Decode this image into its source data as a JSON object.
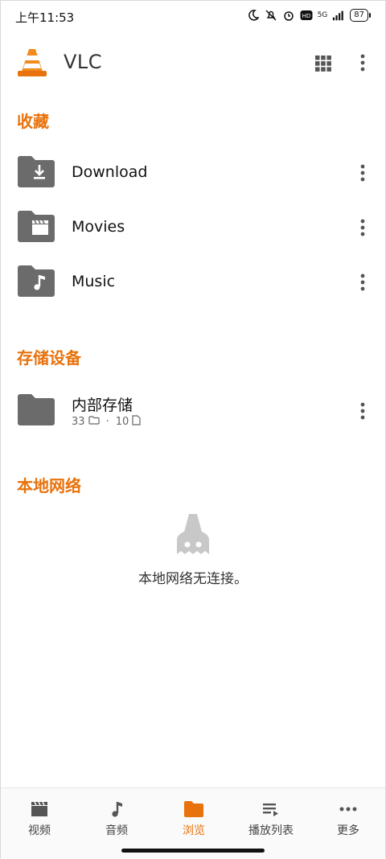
{
  "status": {
    "time": "上午11:53",
    "network": "5G",
    "battery": "87"
  },
  "appbar": {
    "title": "VLC"
  },
  "favorites": {
    "title": "收藏",
    "items": [
      {
        "label": "Download",
        "icon": "download-folder-icon"
      },
      {
        "label": "Movies",
        "icon": "movie-folder-icon"
      },
      {
        "label": "Music",
        "icon": "music-folder-icon"
      }
    ]
  },
  "storage": {
    "title": "存储设备",
    "items": [
      {
        "label": "内部存储",
        "folders": "33",
        "sep": "·",
        "files": "10"
      }
    ]
  },
  "network": {
    "title": "本地网络",
    "empty_text": "本地网络无连接。"
  },
  "bottomnav": {
    "items": [
      {
        "label": "视频",
        "icon": "video-icon"
      },
      {
        "label": "音频",
        "icon": "audio-icon"
      },
      {
        "label": "浏览",
        "icon": "browse-folder-icon",
        "active": true
      },
      {
        "label": "播放列表",
        "icon": "playlist-icon"
      },
      {
        "label": "更多",
        "icon": "more-horizontal-icon"
      }
    ]
  },
  "colors": {
    "accent": "#e8720c",
    "folder": "#6b6b6b"
  }
}
